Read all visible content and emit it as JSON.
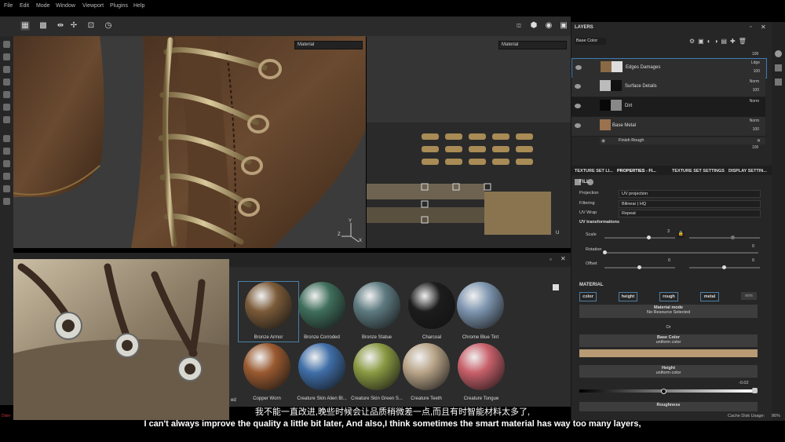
{
  "menu": [
    "File",
    "Edit",
    "Mode",
    "Window",
    "Viewport",
    "Plugins",
    "Help"
  ],
  "viewport": {
    "left_channel": "Material",
    "right_channel": "Material",
    "axes": {
      "x": "X",
      "y": "Y",
      "z": "Z",
      "u": "U"
    }
  },
  "layers": {
    "title": "LAYERS",
    "channel": "Base Color",
    "top_opacity": "100",
    "items": [
      {
        "name": "Edges Damages",
        "blend": "Ldge",
        "opacity": "100"
      },
      {
        "name": "Surface Details",
        "blend": "Norm",
        "opacity": "100"
      },
      {
        "name": "Dirt",
        "blend": "Norm",
        "opacity": ""
      },
      {
        "name": "Base Metal",
        "blend": "Norm",
        "opacity": "100"
      }
    ],
    "sub_effect": {
      "name": "Finish Rough",
      "opacity": "100"
    }
  },
  "tabs": [
    "TEXTURE SET LI...",
    "PROPERTIES - FI...",
    "TEXTURE SET SETTINGS",
    "DISPLAY SETTIN..."
  ],
  "properties": {
    "section": "FILL",
    "projection_label": "Projection",
    "projection_value": "UV projection",
    "filtering_label": "Filtering",
    "filtering_value": "Bilinear | HQ",
    "uvwrap_label": "UV Wrap",
    "uvwrap_value": "Repeat",
    "uv_transform": "UV transformations",
    "scale_label": "Scale",
    "scale_value": "3",
    "rotation_label": "Rotation",
    "rotation_value": "0",
    "offset_label": "Offset",
    "offset_x": "0",
    "offset_y": "0",
    "material_section": "MATERIAL",
    "channels": [
      "color",
      "height",
      "rough",
      "metal",
      "nrm"
    ],
    "material_mode": "Material mode",
    "no_resource": "No Resource Selected",
    "or": "Or",
    "base_color": "Base Color",
    "uniform_color": "uniform color",
    "height": "Height",
    "height_uniform": "uniform color",
    "height_value": "-0.02",
    "roughness": "Roughness"
  },
  "shelf": {
    "materials": [
      {
        "label": "Bronze Armor",
        "color": "#7a5a38"
      },
      {
        "label": "Bronze Corroded",
        "color": "#3f6e5c"
      },
      {
        "label": "Bronze Statue",
        "color": "#5d7a80"
      },
      {
        "label": "Charcoal",
        "color": "#1c1c1c"
      },
      {
        "label": "Chrome Blue Tint",
        "color": "#7e96b0"
      },
      {
        "label": "Copper Worn",
        "color": "#9a5a30"
      },
      {
        "label": "Creature Skin Alien Bl...",
        "color": "#3f6ea8"
      },
      {
        "label": "Creature Skin Green S...",
        "color": "#8a9a42"
      },
      {
        "label": "Creature Teeth",
        "color": "#b8a488"
      },
      {
        "label": "Creature Tongue",
        "color": "#c8606a"
      }
    ],
    "partial_label": "ed"
  },
  "status": {
    "cache": "Cache Disk Usage:",
    "percent": "86%",
    "left": "Dixie"
  },
  "subtitles": {
    "cn": "我不能一直改进,晚些时候会让品质稍微差一点,而且有时智能材料太多了,",
    "en": "I can't always improve the quality a little bit later, And also,I think sometimes the smart material has way too many layers,"
  }
}
